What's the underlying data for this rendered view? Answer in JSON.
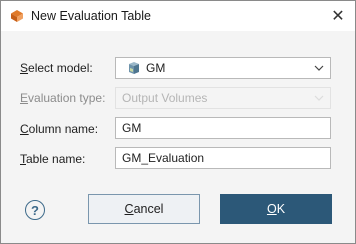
{
  "window": {
    "title": "New Evaluation Table",
    "close_symbol": "✕"
  },
  "form": {
    "select_model": {
      "label_first": "S",
      "label_rest": "elect model:",
      "value": "GM",
      "icon": "model-icon"
    },
    "evaluation_type": {
      "label_first": "E",
      "label_rest": "valuation type:",
      "value": "Output Volumes"
    },
    "column_name": {
      "label_first": "C",
      "label_rest": "olumn name:",
      "value": "GM"
    },
    "table_name": {
      "label_first": "T",
      "label_rest": "able name:",
      "value": "GM_Evaluation"
    }
  },
  "buttons": {
    "help_symbol": "?",
    "cancel": {
      "label_first": "C",
      "label_rest": "ancel"
    },
    "ok": {
      "label_first": "O",
      "label_rest": "K"
    }
  },
  "colors": {
    "accent": "#2c5878",
    "window_bg": "#f4f4f4"
  }
}
